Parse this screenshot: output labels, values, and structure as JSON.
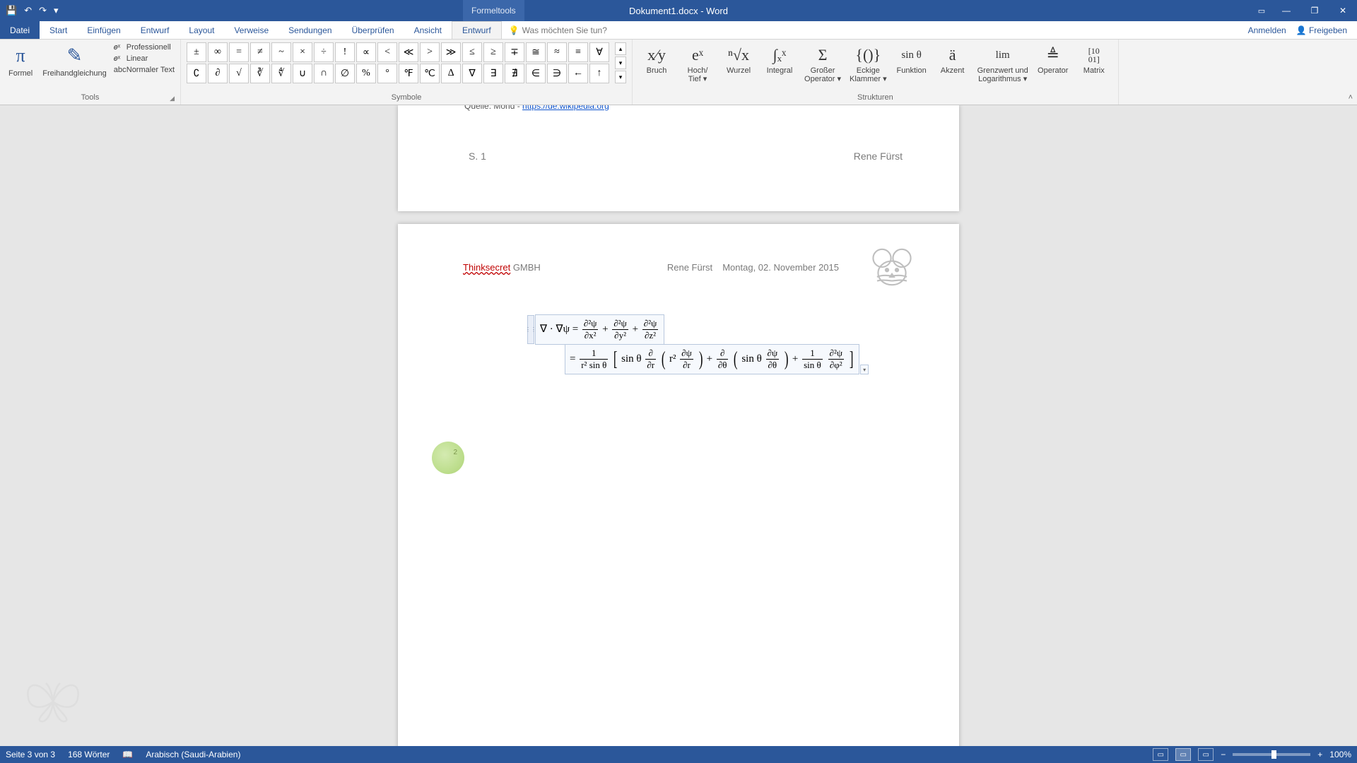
{
  "title_context": "Formeltools",
  "doc_title": "Dokument1.docx - Word",
  "qat": {
    "save": "💾",
    "undo": "↶",
    "redo": "↷",
    "custom": "▾"
  },
  "win": {
    "opts": "▭",
    "min": "—",
    "max": "❐",
    "close": "✕"
  },
  "tabs": {
    "file": "Datei",
    "start": "Start",
    "insert": "Einfügen",
    "design1": "Entwurf",
    "layout": "Layout",
    "references": "Verweise",
    "mailings": "Sendungen",
    "review": "Überprüfen",
    "view": "Ansicht",
    "developer": "Entwurf"
  },
  "tellme": "Was möchten Sie tun?",
  "account": {
    "signin": "Anmelden",
    "share": "Freigeben"
  },
  "groups": {
    "tools": "Tools",
    "symbols": "Symbole",
    "structures": "Strukturen"
  },
  "tools": {
    "formula": "Formel",
    "ink": "Freihandgleichung",
    "professional": "Professionell",
    "linear": "Linear",
    "normaltext": "Normaler Text"
  },
  "symbols_row1": [
    "±",
    "∞",
    "=",
    "≠",
    "~",
    "×",
    "÷",
    "!",
    "∝",
    "<",
    "≪",
    ">",
    "≫",
    "≤",
    "≥",
    "∓",
    "≅",
    "≈",
    "≡",
    "∀"
  ],
  "symbols_row2": [
    "∁",
    "∂",
    "√",
    "∛",
    "∜",
    "∪",
    "∩",
    "∅",
    "%",
    "°",
    "℉",
    "℃",
    "∆",
    "∇",
    "∃",
    "∄",
    "∈",
    "∋",
    "←",
    "↑"
  ],
  "struct": {
    "fraction": "Bruch",
    "script": "Hoch/\nTief ▾",
    "radical": "Wurzel",
    "integral": "Integral",
    "largeop": "Großer\nOperator ▾",
    "bracket": "Eckige\nKlammer ▾",
    "function": "Funktion",
    "accent": "Akzent",
    "limit": "Grenzwert und\nLogarithmus ▾",
    "operator": "Operator",
    "matrix": "Matrix"
  },
  "struct_icons": {
    "fraction": "x⁄y",
    "script": "eˣ",
    "radical": "ⁿ√x",
    "integral": "∫ₓˣ",
    "largeop": "Σ",
    "bracket": "{()}",
    "function": "sin θ",
    "accent": "ä",
    "limit": "lim",
    "operator": "≜",
    "matrix": "[10\n01]"
  },
  "prev_page": {
    "tail_prefix": "Quelle: Mond - ",
    "tail_link": "https://de.wikipedia.org",
    "footer_page": "S. 1",
    "footer_author": "Rene Fürst"
  },
  "header": {
    "company_secret": "Thinksecret",
    "company_rest": " GMBH",
    "author": "Rene Fürst",
    "date": "Montag, 02. November 2015"
  },
  "equation": {
    "line1_lhs": "∇ · ∇ψ =",
    "d2psi": "∂²ψ",
    "dx2": "∂x²",
    "dy2": "∂y²",
    "dz2": "∂z²",
    "plus": "+",
    "eq": "=",
    "one": "1",
    "r2sin": "r² sin θ",
    "sintheta": "sin θ",
    "ddr": "∂",
    "dr": "∂r",
    "r2": "r²",
    "dpsi": "∂ψ",
    "ddtheta": "∂",
    "dtheta": "∂θ",
    "sintheta2": "sin θ",
    "dphi2": "∂φ²"
  },
  "green_badge": "2",
  "status": {
    "page": "Seite 3 von 3",
    "words": "168 Wörter",
    "lang": "Arabisch (Saudi-Arabien)",
    "zoom": "100%"
  }
}
